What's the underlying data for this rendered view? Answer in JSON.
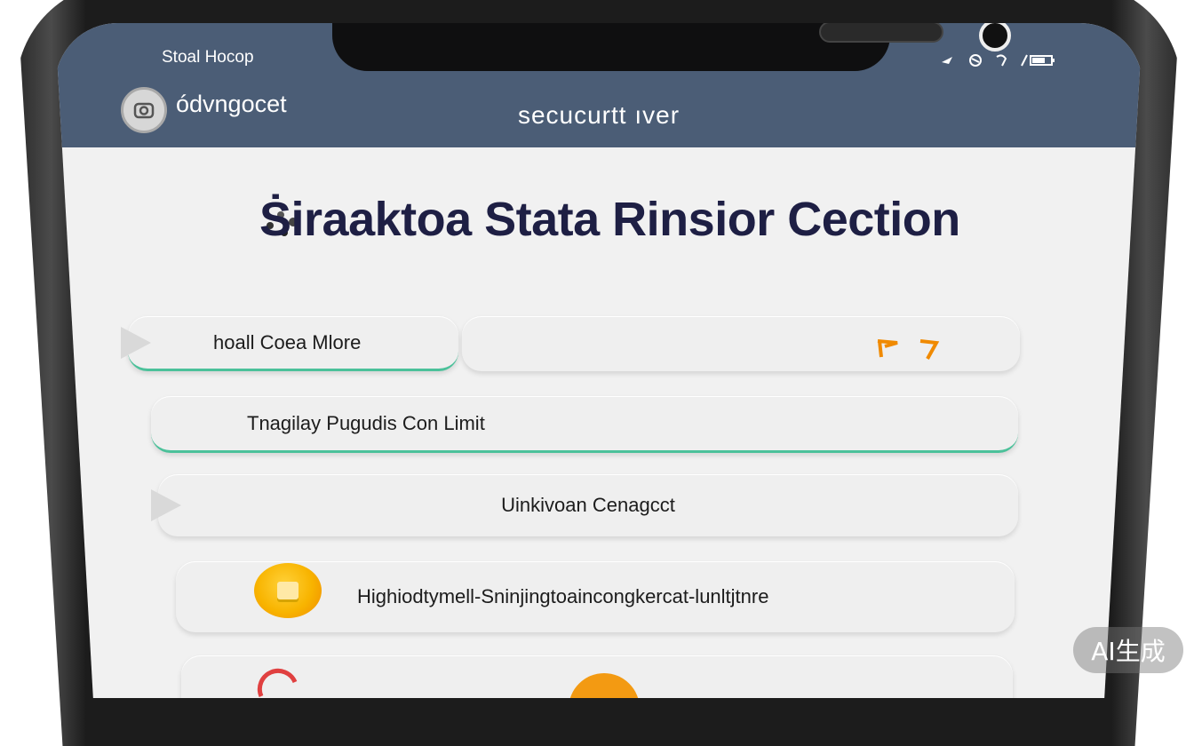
{
  "status_bar": {
    "left_text": "Stoal Hocop",
    "right_icons": [
      "signal-icon",
      "wifi-icon",
      "sync-icon",
      "battery-icon"
    ]
  },
  "app_bar": {
    "app_name": "ódvngocet",
    "screen_title": "secucurtt ıver"
  },
  "heading": "Ṡiraaktoa Stata  Rinsior Cection",
  "items": [
    {
      "label": "hoall Coea Mlore",
      "icon": "chevron-left-icon",
      "right_icons": [
        "arrow-down-right-icon",
        "arrow-up-right-icon"
      ]
    },
    {
      "label": "Tnagilay Pugudis Con Limit"
    },
    {
      "label": "Uinkivoan Cenagcct",
      "icon": "chevron-left-icon"
    },
    {
      "label": "Highiodtymell-Sninjingtoaincongkercat-lunltjtnre",
      "icon": "badge-icon"
    }
  ],
  "colors": {
    "topbar": "#4b5d76",
    "accent_green": "#4bc19a",
    "accent_orange": "#f08a00",
    "heading": "#1e1f44"
  },
  "watermark": "AI生成"
}
